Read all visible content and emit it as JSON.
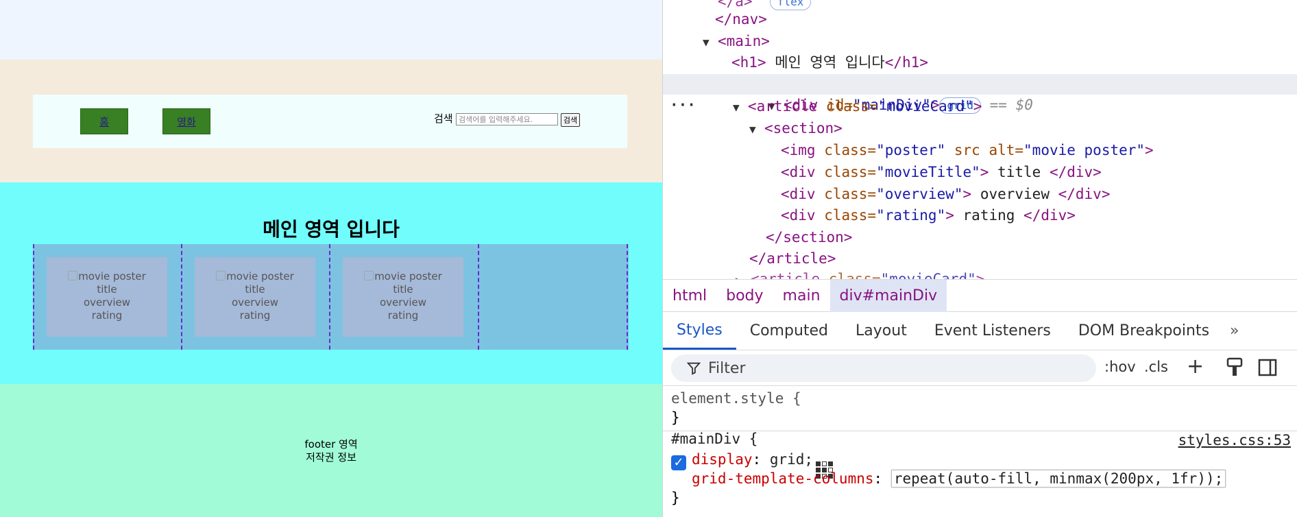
{
  "preview": {
    "nav": {
      "items": [
        {
          "label": "홈"
        },
        {
          "label": "영화"
        }
      ],
      "search_label": "검색",
      "search_placeholder": "검색어를 입력해주세요.",
      "search_button": "검색"
    },
    "main_heading": "메인 영역 입니다",
    "movie_cards": [
      {
        "poster_alt": "movie poster",
        "title": "title",
        "overview": "overview",
        "rating": "rating"
      },
      {
        "poster_alt": "movie poster",
        "title": "title",
        "overview": "overview",
        "rating": "rating"
      },
      {
        "poster_alt": "movie poster",
        "title": "title",
        "overview": "overview",
        "rating": "rating"
      }
    ],
    "footer": {
      "line1": "footer 영역",
      "line2": "저작권 정보"
    }
  },
  "devtools": {
    "dom": {
      "nav_close": "</nav>",
      "main_open": "<main>",
      "h1_open": "<h1>",
      "h1_text": " 메인 영역 입니다",
      "h1_close": "</h1>",
      "div_open": "<div ",
      "div_attr": "id=",
      "div_val": "\"mainDiv\"",
      "div_end": ">",
      "grid_badge": "grid",
      "eq": "== $0",
      "article_open": "<article ",
      "class_attr": "class=",
      "article_val": "\"movieCard\"",
      "section_open": "<section>",
      "img_tag": "<img ",
      "img_class_val": "\"poster\"",
      "img_src_attr": " src",
      "img_alt_attr": " alt=",
      "img_alt_val": "\"movie poster\"",
      "title_val": "\"movieTitle\"",
      "title_text": " title ",
      "overview_val": "\"overview\"",
      "overview_text": " overview ",
      "rating_val": "\"rating\"",
      "rating_text": " rating ",
      "div_close": "</div>",
      "section_close": "</section>",
      "article_close": "</article>"
    },
    "breadcrumbs": [
      "html",
      "body",
      "main",
      "div#mainDiv"
    ],
    "tabs": [
      "Styles",
      "Computed",
      "Layout",
      "Event Listeners",
      "DOM Breakpoints"
    ],
    "tab_more": "»",
    "filter_placeholder": "Filter",
    "tools": {
      "hov": ":hov",
      "cls": ".cls"
    },
    "styles": {
      "element_style": "element.style {",
      "close_brace": "}",
      "rule_selector": "#mainDiv {",
      "rule_source": "styles.css:53",
      "prop1": "display",
      "val1": " grid;",
      "prop2": "grid-template-columns",
      "val2": "repeat(auto-fill, minmax(200px, 1fr));"
    }
  }
}
